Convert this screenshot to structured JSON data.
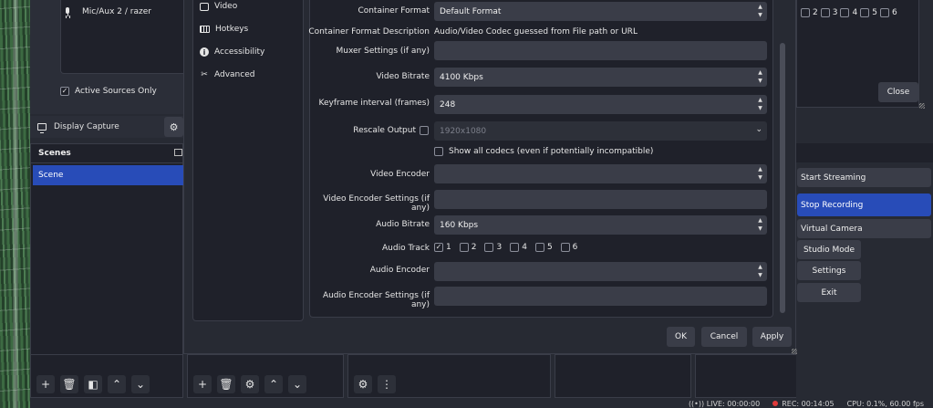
{
  "main": {
    "mixer": {
      "source_name": "Mic/Aux 2 / razer",
      "active_only_label": "Active Sources Only"
    },
    "source_tab": {
      "label": "Display Capture"
    },
    "scenes": {
      "header": "Scenes",
      "items": [
        "Scene"
      ]
    },
    "audio_tracks_partial": [
      "2",
      "3",
      "4",
      "5",
      "6"
    ],
    "close_label": "Close",
    "controls": {
      "start_streaming": "Start Streaming",
      "stop_recording": "Stop Recording",
      "virtual_camera": "Virtual Camera",
      "studio_mode": "Studio Mode",
      "settings": "Settings",
      "exit": "Exit"
    },
    "status": {
      "live": "LIVE: 00:00:00",
      "rec": "REC: 00:14:05",
      "cpu": "CPU: 0.1%, 60.00 fps"
    }
  },
  "settings_dialog": {
    "sidebar": [
      {
        "label": "Video",
        "icon": "video-icon"
      },
      {
        "label": "Hotkeys",
        "icon": "keyboard-icon"
      },
      {
        "label": "Accessibility",
        "icon": "accessibility-icon"
      },
      {
        "label": "Advanced",
        "icon": "advanced-tools-icon"
      }
    ],
    "fields": {
      "container_format": {
        "label": "Container Format",
        "value": "Default Format"
      },
      "container_format_desc": {
        "label": "Container Format Description",
        "value": "Audio/Video Codec guessed from File path or URL"
      },
      "muxer_settings": {
        "label": "Muxer Settings (if any)",
        "value": ""
      },
      "video_bitrate": {
        "label": "Video Bitrate",
        "value": "4100 Kbps"
      },
      "keyframe_interval": {
        "label": "Keyframe interval (frames)",
        "value": "248"
      },
      "rescale_output": {
        "label": "Rescale Output",
        "value": "1920x1080",
        "checked": false
      },
      "show_all_codecs": {
        "label": "Show all codecs (even if potentially incompatible)",
        "checked": false
      },
      "video_encoder": {
        "label": "Video Encoder",
        "value": ""
      },
      "video_encoder_settings": {
        "label": "Video Encoder Settings (if any)",
        "value": ""
      },
      "audio_bitrate": {
        "label": "Audio Bitrate",
        "value": "160 Kbps"
      },
      "audio_track": {
        "label": "Audio Track",
        "tracks": [
          "1",
          "2",
          "3",
          "4",
          "5",
          "6"
        ],
        "checked": [
          true,
          false,
          false,
          false,
          false,
          false
        ]
      },
      "audio_encoder": {
        "label": "Audio Encoder",
        "value": ""
      },
      "audio_encoder_settings": {
        "label": "Audio Encoder Settings (if any)",
        "value": ""
      }
    },
    "buttons": {
      "ok": "OK",
      "cancel": "Cancel",
      "apply": "Apply"
    }
  },
  "colors": {
    "accent": "#284cb8",
    "panel": "#1f212a",
    "field": "#3a3d48",
    "rec_dot": "#e03a3a"
  }
}
